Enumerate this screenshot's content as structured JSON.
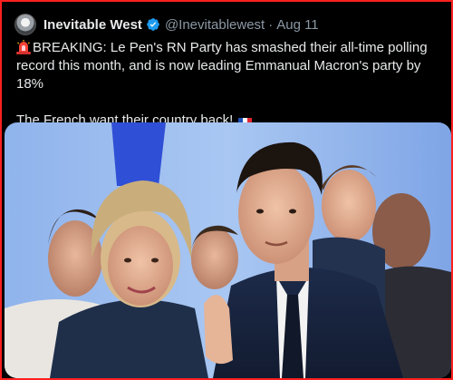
{
  "tweet": {
    "author": {
      "display_name": "Inevitable West",
      "handle": "@Inevitablewest",
      "verified": true,
      "avatar_icon": "avatar-icon"
    },
    "separator": "·",
    "date": "Aug 11",
    "text_line1": "BREAKING: Le Pen's RN Party has smashed their all-time polling record this month, and is now leading Emmanual Macron's party by 18%",
    "text_line2": "The French want their country back!",
    "emoji_icons": [
      "siren-icon",
      "france-flag-icon"
    ],
    "media": {
      "type": "photo"
    }
  },
  "colors": {
    "background": "#000000",
    "text": "#e7e9ea",
    "secondary_text": "#8b98a5",
    "verified_badge": "#1d9bf0",
    "frame_border": "#ff1f1f"
  }
}
